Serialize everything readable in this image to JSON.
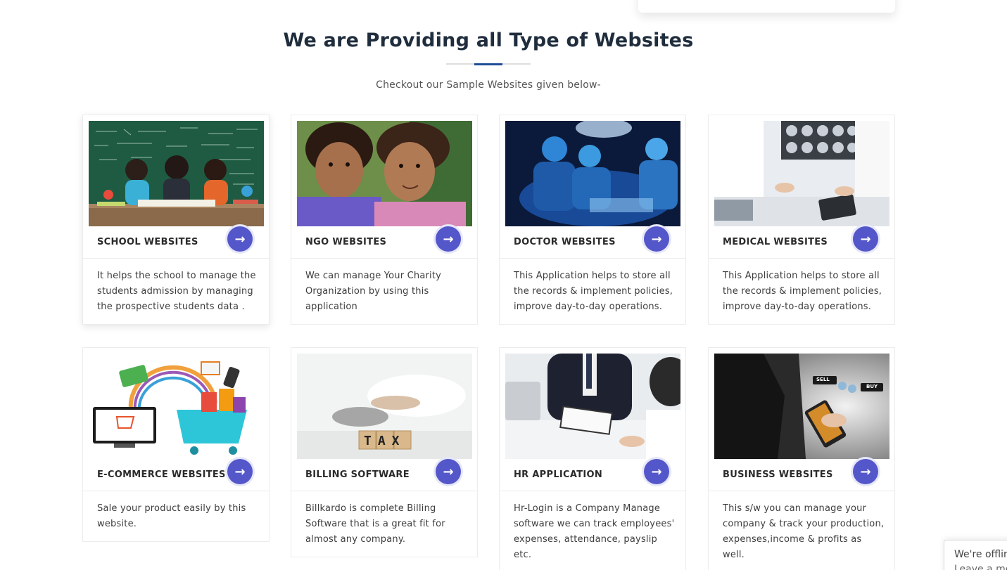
{
  "section": {
    "title": "We are Providing all Type of Websites",
    "subtitle": "Checkout our Sample Websites given below-"
  },
  "colors": {
    "accent": "#5457c9",
    "heading": "#1f2d3d",
    "divider_accent": "#1f4e96"
  },
  "cards": [
    {
      "title": "SCHOOL WEBSITES",
      "image": "children-studying-at-chalkboard-photo",
      "arrow_icon": "arrow-right-icon",
      "description": "It helps the school to manage the students admission by managing the prospective students data ."
    },
    {
      "title": "NGO WEBSITES",
      "image": "two-smiling-children-photo",
      "arrow_icon": "arrow-right-icon",
      "description": "We can manage Your Charity Organization by using this application"
    },
    {
      "title": "DOCTOR WEBSITES",
      "image": "surgeons-in-operating-room-photo",
      "arrow_icon": "arrow-right-icon",
      "description": "This Application helps to store all the records & implement policies, improve day-to-day operations."
    },
    {
      "title": "MEDICAL WEBSITES",
      "image": "doctors-reviewing-scans-photo",
      "arrow_icon": "arrow-right-icon",
      "description": "This Application helps to store all the records & implement policies, improve day-to-day operations."
    },
    {
      "title": "E-COMMERCE WEBSITES",
      "image": "shopping-cart-illustration",
      "arrow_icon": "arrow-right-icon",
      "description": "Sale your product easily by this website."
    },
    {
      "title": "BILLING SOFTWARE",
      "image": "tax-blocks-photo",
      "arrow_icon": "arrow-right-icon",
      "description": "Billkardo is complete Billing Software that is a great fit for almost any company."
    },
    {
      "title": "HR APPLICATION",
      "image": "job-interview-photo",
      "arrow_icon": "arrow-right-icon",
      "description": "Hr-Login is a Company Manage software we can track employees' expenses, attendance, payslip etc."
    },
    {
      "title": "BUSINESS WEBSITES",
      "image": "businessman-with-smartphone-photo",
      "arrow_icon": "arrow-right-icon",
      "description": "This s/w you can manage your company & track your production, expenses,income & profits as well."
    }
  ],
  "image_text": {
    "tax_block_letters": "TAX",
    "sell_label": "SELL",
    "buy_label": "BUY"
  },
  "chat_widget": {
    "line1": "We're offline",
    "line2": "Leave a message"
  }
}
